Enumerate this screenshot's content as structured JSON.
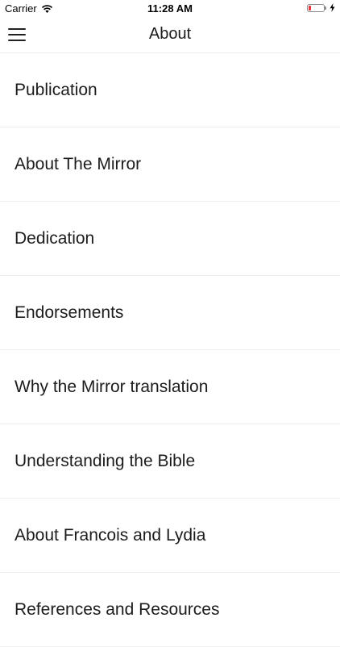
{
  "status_bar": {
    "carrier": "Carrier",
    "time": "11:28 AM",
    "battery_level": 0.15,
    "battery_color": "#e8333a",
    "charging": true
  },
  "nav_bar": {
    "title": "About",
    "menu_icon": "hamburger-menu-icon"
  },
  "list": {
    "items": [
      {
        "label": "Publication"
      },
      {
        "label": "About The Mirror"
      },
      {
        "label": "Dedication"
      },
      {
        "label": "Endorsements"
      },
      {
        "label": "Why the Mirror translation"
      },
      {
        "label": "Understanding the Bible"
      },
      {
        "label": "About Francois and Lydia"
      },
      {
        "label": "References and Resources"
      }
    ]
  }
}
